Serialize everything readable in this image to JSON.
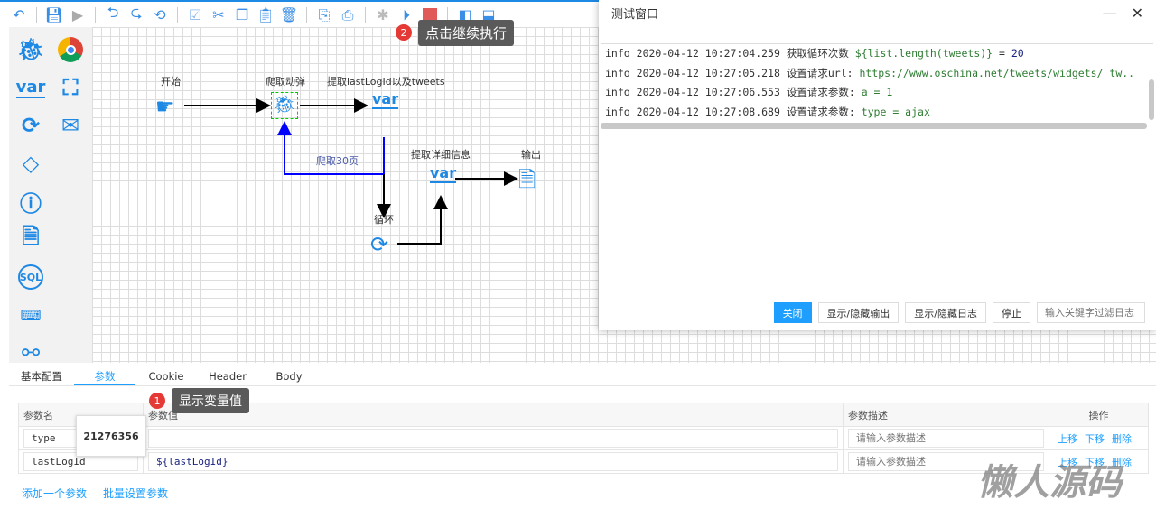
{
  "toolbar": {
    "icons": [
      "undo-icon",
      "save-icon",
      "run-icon",
      "undo-arrow-icon",
      "redo-arrow-icon",
      "history-icon",
      "select-all-icon",
      "cut-icon",
      "copy-icon",
      "paste-icon",
      "delete-icon",
      "import-icon",
      "print-icon",
      "debug-icon",
      "continue-icon",
      "stop-icon",
      "layout-left-icon",
      "layout-bottom-icon"
    ]
  },
  "tooltip_continue": {
    "badge": "2",
    "text": "点击继续执行"
  },
  "palette": {
    "var_label": "var"
  },
  "flow": {
    "start": "开始",
    "crawl": "爬取动弹",
    "extract": "提取lastLogId以及tweets",
    "loop_label": "爬取30页",
    "detail": "提取详细信息",
    "output": "输出",
    "loop": "循环",
    "var1": "var",
    "var2": "var"
  },
  "log_window": {
    "title": "测试窗口",
    "lines": [
      {
        "level": "info",
        "time": "2020-04-12 10:27:04.259",
        "msg": "获取循环次数",
        "expr": "${list.length(tweets)}",
        "op": " = ",
        "val": "20"
      },
      {
        "level": "info",
        "time": "2020-04-12 10:27:05.218",
        "msg": "设置请求url:",
        "expr": "https://www.oschina.net/tweets/widgets/_tw..",
        "op": "",
        "val": ""
      },
      {
        "level": "info",
        "time": "2020-04-12 10:27:06.553",
        "msg": "设置请求参数:",
        "expr": " a = 1",
        "op": "",
        "val": ""
      },
      {
        "level": "info",
        "time": "2020-04-12 10:27:08.689",
        "msg": "设置请求参数:",
        "expr": " type = ajax",
        "op": "",
        "val": ""
      }
    ],
    "buttons": {
      "close": "关闭",
      "toggle_output": "显示/隐藏输出",
      "toggle_log": "显示/隐藏日志",
      "stop": "停止"
    },
    "filter_placeholder": "输入关键字过滤日志"
  },
  "tabs": [
    "基本配置",
    "参数",
    "Cookie",
    "Header",
    "Body"
  ],
  "tooltip_var": {
    "badge": "1",
    "text": "显示变量值"
  },
  "params": {
    "headers": [
      "参数名",
      "参数值",
      "参数描述",
      "操作"
    ],
    "rows": [
      {
        "name": "type",
        "value": ""
      },
      {
        "name": "lastLogId",
        "value": "${lastLogId}"
      }
    ],
    "desc_placeholder": "请输入参数描述",
    "ops": [
      "上移",
      "下移",
      "删除"
    ],
    "popup_value": "21276356",
    "add": "添加一个参数",
    "batch": "批量设置参数"
  },
  "watermark": "懒人源码"
}
